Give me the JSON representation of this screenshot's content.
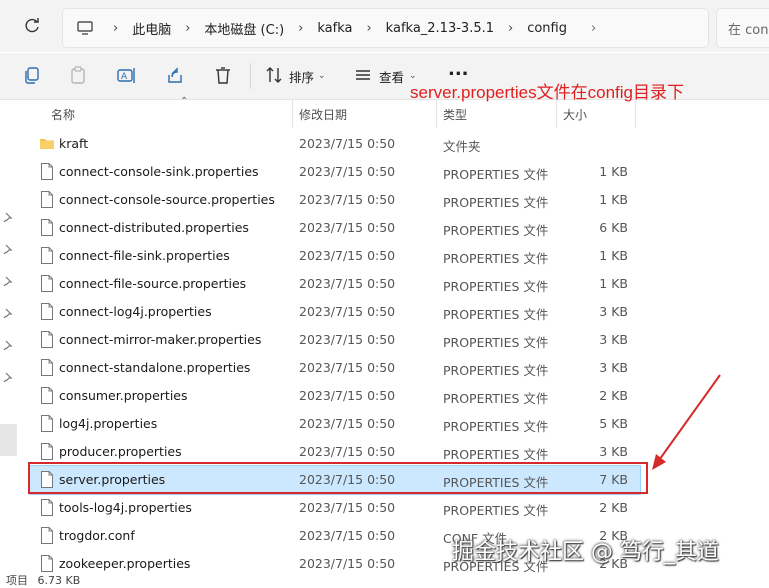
{
  "address": {
    "crumbs": [
      "此电脑",
      "本地磁盘 (C:)",
      "kafka",
      "kafka_2.13-3.5.1",
      "config"
    ],
    "search_placeholder": "在 con"
  },
  "toolbar": {
    "sort_label": "排序",
    "view_label": "查看",
    "more_label": "..."
  },
  "annotation": "server.properties文件在config目录下",
  "columns": {
    "name": "名称",
    "date": "修改日期",
    "type": "类型",
    "size": "大小"
  },
  "files": [
    {
      "name": "kraft",
      "date": "2023/7/15 0:50",
      "type": "文件夹",
      "size": "",
      "kind": "folder"
    },
    {
      "name": "connect-console-sink.properties",
      "date": "2023/7/15 0:50",
      "type": "PROPERTIES 文件",
      "size": "1 KB",
      "kind": "file"
    },
    {
      "name": "connect-console-source.properties",
      "date": "2023/7/15 0:50",
      "type": "PROPERTIES 文件",
      "size": "1 KB",
      "kind": "file"
    },
    {
      "name": "connect-distributed.properties",
      "date": "2023/7/15 0:50",
      "type": "PROPERTIES 文件",
      "size": "6 KB",
      "kind": "file"
    },
    {
      "name": "connect-file-sink.properties",
      "date": "2023/7/15 0:50",
      "type": "PROPERTIES 文件",
      "size": "1 KB",
      "kind": "file"
    },
    {
      "name": "connect-file-source.properties",
      "date": "2023/7/15 0:50",
      "type": "PROPERTIES 文件",
      "size": "1 KB",
      "kind": "file"
    },
    {
      "name": "connect-log4j.properties",
      "date": "2023/7/15 0:50",
      "type": "PROPERTIES 文件",
      "size": "3 KB",
      "kind": "file"
    },
    {
      "name": "connect-mirror-maker.properties",
      "date": "2023/7/15 0:50",
      "type": "PROPERTIES 文件",
      "size": "3 KB",
      "kind": "file"
    },
    {
      "name": "connect-standalone.properties",
      "date": "2023/7/15 0:50",
      "type": "PROPERTIES 文件",
      "size": "3 KB",
      "kind": "file"
    },
    {
      "name": "consumer.properties",
      "date": "2023/7/15 0:50",
      "type": "PROPERTIES 文件",
      "size": "2 KB",
      "kind": "file"
    },
    {
      "name": "log4j.properties",
      "date": "2023/7/15 0:50",
      "type": "PROPERTIES 文件",
      "size": "5 KB",
      "kind": "file"
    },
    {
      "name": "producer.properties",
      "date": "2023/7/15 0:50",
      "type": "PROPERTIES 文件",
      "size": "3 KB",
      "kind": "file"
    },
    {
      "name": "server.properties",
      "date": "2023/7/15 0:50",
      "type": "PROPERTIES 文件",
      "size": "7 KB",
      "kind": "file",
      "selected": true
    },
    {
      "name": "tools-log4j.properties",
      "date": "2023/7/15 0:50",
      "type": "PROPERTIES 文件",
      "size": "2 KB",
      "kind": "file"
    },
    {
      "name": "trogdor.conf",
      "date": "2023/7/15 0:50",
      "type": "CONF 文件",
      "size": "2 KB",
      "kind": "file"
    },
    {
      "name": "zookeeper.properties",
      "date": "2023/7/15 0:50",
      "type": "PROPERTIES 文件",
      "size": "2 KB",
      "kind": "file"
    }
  ],
  "status": {
    "items": "项目",
    "size": "6.73 KB"
  },
  "watermark": "掘金技术社区 @ 笃行_其道",
  "colors": {
    "accent": "#cce8ff",
    "annotation": "#e02020",
    "folder": "#f2c14e"
  }
}
